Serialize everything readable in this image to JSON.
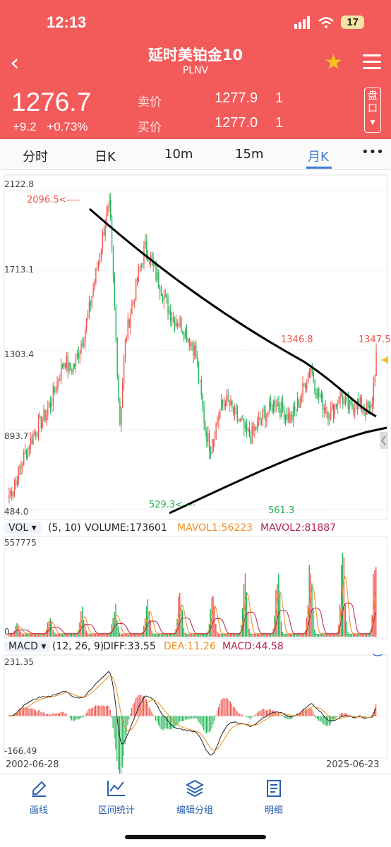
{
  "status": {
    "time": "12:13",
    "battery": "17"
  },
  "header": {
    "title": "延时美铂金10",
    "subtitle": "PLNV"
  },
  "quote": {
    "price": "1276.7",
    "change": "+9.2",
    "change_pct": "+0.73%",
    "sell_label": "卖价",
    "sell_price": "1277.9",
    "sell_qty": "1",
    "buy_label": "买价",
    "buy_price": "1277.0",
    "buy_qty": "1",
    "panel_label": "盘口"
  },
  "tabs": [
    "分时",
    "日K",
    "10m",
    "15m",
    "月K",
    "•••"
  ],
  "active_tab": "月K",
  "chart_data": [
    {
      "type": "candlestick",
      "title": "",
      "y_ticks": [
        "2122.8",
        "1713.1",
        "1303.4",
        "893.7",
        "484.0"
      ],
      "ylim": [
        484.0,
        2122.8
      ],
      "annotations": [
        {
          "label": "2096.5<----",
          "value": 2096.5
        },
        {
          "label": "1346.8",
          "value": 1346.8
        },
        {
          "label": "1347.5",
          "value": 1347.5
        },
        {
          "label": "529.3<----",
          "value": 529.3
        },
        {
          "label": "561.3",
          "value": 561.3
        }
      ],
      "closes_approx": [
        560,
        610,
        680,
        760,
        820,
        880,
        920,
        960,
        1020,
        1090,
        1180,
        1260,
        1200,
        1230,
        1310,
        1400,
        1520,
        1660,
        1800,
        1950,
        2040,
        1500,
        920,
        1320,
        1480,
        1600,
        1720,
        1830,
        1780,
        1700,
        1640,
        1560,
        1500,
        1460,
        1440,
        1400,
        1350,
        1300,
        1100,
        900,
        800,
        900,
        1000,
        1050,
        1010,
        960,
        930,
        880,
        860,
        900,
        950,
        980,
        1000,
        1050,
        1000,
        980,
        950,
        1000,
        1060,
        1150,
        1220,
        1100,
        1050,
        1000,
        980,
        1030,
        1070,
        1020,
        1000,
        1040,
        1010,
        1000,
        990,
        1280
      ]
    },
    {
      "type": "bar",
      "title": "VOL",
      "params": "(5, 10)",
      "volume_label": "VOLUME:173601",
      "mavol1_label": "MAVOL1:56223",
      "mavol2_label": "MAVOL2:81887",
      "y_ticks": [
        "557775",
        "0"
      ],
      "ylim": [
        0,
        557775
      ]
    },
    {
      "type": "line",
      "title": "MACD",
      "params": "(12, 26, 9)",
      "diff_label": "DIFF:33.55",
      "dea_label": "DEA:11.26",
      "macd_label": "MACD:44.58",
      "y_ticks": [
        "231.35",
        "-166.49"
      ],
      "ylim": [
        -166.49,
        231.35
      ],
      "x_start": "2002-06-28",
      "x_end": "2025-06-23"
    }
  ],
  "colors": {
    "header": "#f35a5a",
    "up": "#f0504a",
    "down": "#1fb254",
    "accent": "#3a7bd5",
    "mavol1": "#f08c1e",
    "mavol2": "#b5234a"
  },
  "bottom_nav": [
    {
      "label": "画线",
      "icon": "pencil-icon"
    },
    {
      "label": "区间统计",
      "icon": "range-stats-icon"
    },
    {
      "label": "编辑分组",
      "icon": "layers-icon"
    },
    {
      "label": "明细",
      "icon": "list-detail-icon"
    }
  ]
}
